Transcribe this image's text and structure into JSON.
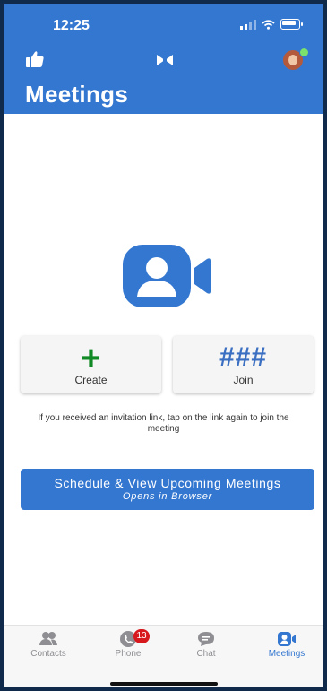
{
  "status_bar": {
    "time": "12:25"
  },
  "header": {
    "title": "Meetings"
  },
  "actions": [
    {
      "label": "Create",
      "glyph": "+"
    },
    {
      "label": "Join",
      "glyph": "###"
    }
  ],
  "hint": "If you received an invitation link, tap on the link again to join the meeting",
  "schedule": {
    "title": "Schedule & View Upcoming Meetings",
    "subtitle": "Opens in Browser"
  },
  "tabs": [
    {
      "label": "Contacts",
      "icon": "contacts-icon"
    },
    {
      "label": "Phone",
      "icon": "phone-icon",
      "badge": "13"
    },
    {
      "label": "Chat",
      "icon": "chat-icon"
    },
    {
      "label": "Meetings",
      "icon": "meetings-icon",
      "active": true
    }
  ],
  "colors": {
    "brand_blue": "#3477d0",
    "create_green": "#118a26",
    "join_blue": "#3b6fc2",
    "badge_red": "#d7181d",
    "presence_green": "#7be36b"
  }
}
